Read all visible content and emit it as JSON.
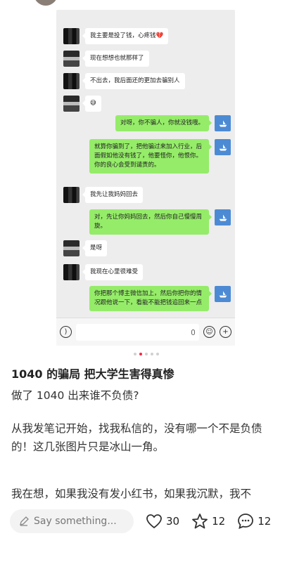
{
  "chat": {
    "messages": [
      {
        "side": "left",
        "text": "我主要是投了钱，心疼钱💔"
      },
      {
        "side": "left",
        "text": "现在想想也就那样了"
      },
      {
        "side": "left",
        "text": "不出去，我后面还的更加去骗别人"
      },
      {
        "side": "left",
        "text": "😅"
      },
      {
        "side": "right",
        "text": "对呀，你不骗人，你就没钱哦。"
      },
      {
        "side": "right",
        "text": "就算你骗到了，把他骗过来加入行业，后面假如他没有钱了，他要怪你，他恨你。你的良心会受到谴责的。"
      },
      {
        "side": "left",
        "text": "我先让我妈妈回去"
      },
      {
        "side": "right",
        "text": "对，先让你妈妈回去，然后你自己慢慢周旋。"
      },
      {
        "side": "left",
        "text": "是呀"
      },
      {
        "side": "left",
        "text": "我现在心里很难受"
      },
      {
        "side": "right",
        "text": "你把那个博主微信加上，然后你把你的情况跟他说一下，看能不能把钱追回来一点"
      }
    ]
  },
  "post": {
    "title": "1040 的骗局 把大学生害得真惨",
    "para1": "做了 1040 出来谁不负债?",
    "para2": "从我发笔记开始，找我私信的，没有哪一个不是负债的！这几张图片只是冰山一角。",
    "para3": "我在想，如果我没有发小红书，如果我沉默，我不"
  },
  "bottom": {
    "comment_placeholder": "Say something...",
    "likes": "30",
    "favorites": "12",
    "comments": "12"
  },
  "pager": {
    "count": 5,
    "active": 1
  },
  "colors": {
    "accent": "#ff2442",
    "wechat_green": "#95ec69"
  }
}
